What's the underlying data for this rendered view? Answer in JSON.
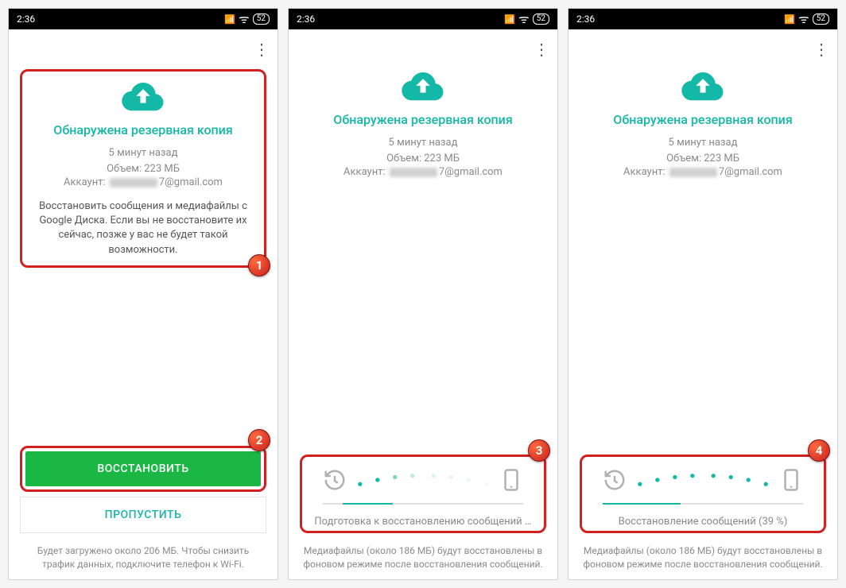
{
  "status": {
    "time": "2:36",
    "battery": "52"
  },
  "header": {
    "title": "Обнаружена резервная копия",
    "time_ago": "5 минут назад",
    "size": "Объем: 223 МБ",
    "account_prefix": "Аккаунт: ",
    "account_suffix": "7@gmail.com"
  },
  "screen1": {
    "desc": "Восстановить сообщения и медиафайлы с Google Диска. Если вы не восстановите их сейчас, позже у вас не будет такой возможности.",
    "restore_label": "ВОССТАНОВИТЬ",
    "skip_label": "ПРОПУСТИТЬ",
    "footer": "Будет загружено около 206 МБ. Чтобы снизить трафик данных, подключите телефон к Wi-Fi."
  },
  "screen2": {
    "progress_text": "Подготовка к восстановлению сообщений …",
    "footer": "Медиафайлы (около 186 МБ) будут восстановлены в фоновом режиме после восстановления сообщений."
  },
  "screen3": {
    "progress_text": "Восстановление сообщений (39 %)",
    "progress_percent": 39,
    "footer": "Медиафайлы (около 186 МБ) будут восстановлены в фоновом режиме после восстановления сообщений."
  },
  "badges": {
    "b1": "1",
    "b2": "2",
    "b3": "3",
    "b4": "4"
  },
  "colors": {
    "teal": "#14b8a6",
    "green": "#1ab744",
    "red": "#d22020"
  }
}
